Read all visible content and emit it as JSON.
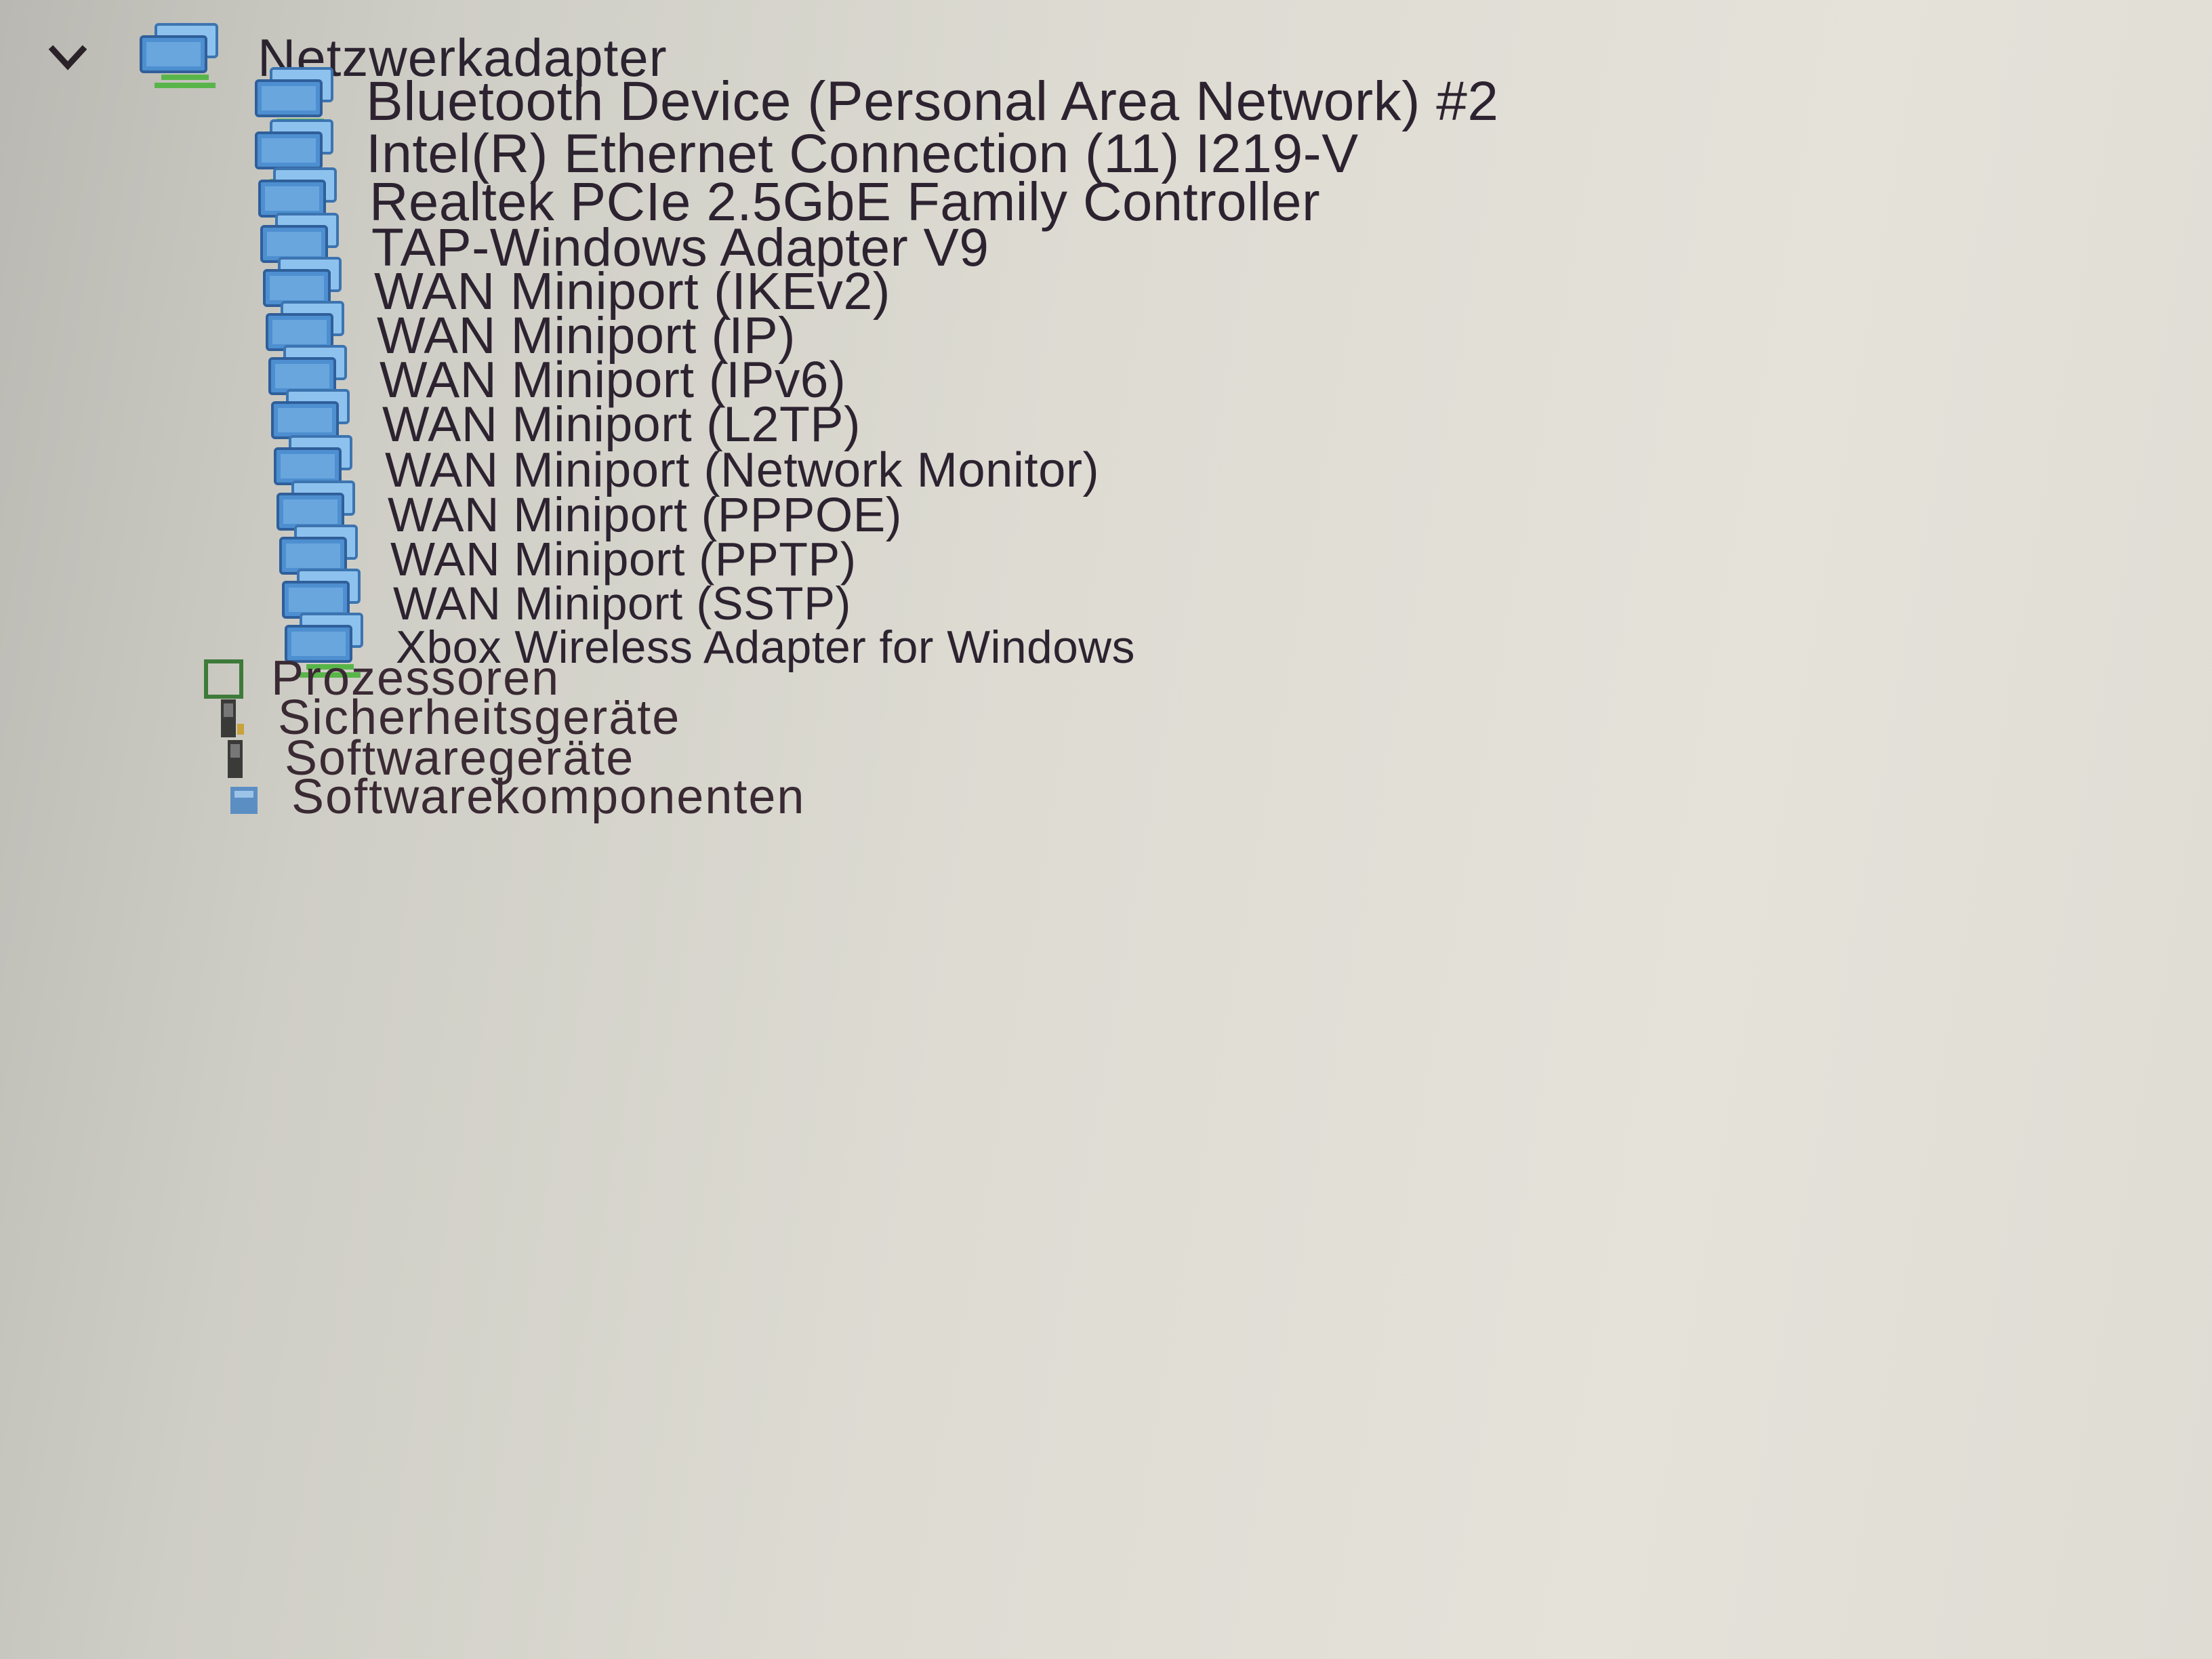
{
  "tree": {
    "parent": {
      "label": "Netzwerkadapter",
      "icon": "network-adapter-icon",
      "expanded": true
    },
    "children": [
      {
        "label": "Bluetooth Device (Personal Area Network) #2",
        "icon": "network-adapter-icon"
      },
      {
        "label": "Intel(R) Ethernet Connection (11) I219-V",
        "icon": "network-adapter-icon"
      },
      {
        "label": "Realtek PCIe 2.5GbE Family Controller",
        "icon": "network-adapter-icon"
      },
      {
        "label": "TAP-Windows Adapter V9",
        "icon": "network-adapter-icon"
      },
      {
        "label": "WAN Miniport (IKEv2)",
        "icon": "network-adapter-icon"
      },
      {
        "label": "WAN Miniport (IP)",
        "icon": "network-adapter-icon"
      },
      {
        "label": "WAN Miniport (IPv6)",
        "icon": "network-adapter-icon"
      },
      {
        "label": "WAN Miniport (L2TP)",
        "icon": "network-adapter-icon"
      },
      {
        "label": "WAN Miniport (Network Monitor)",
        "icon": "network-adapter-icon"
      },
      {
        "label": "WAN Miniport (PPPOE)",
        "icon": "network-adapter-icon"
      },
      {
        "label": "WAN Miniport (PPTP)",
        "icon": "network-adapter-icon"
      },
      {
        "label": "WAN Miniport (SSTP)",
        "icon": "network-adapter-icon"
      },
      {
        "label": "Xbox Wireless Adapter for Windows",
        "icon": "network-adapter-icon"
      }
    ],
    "categories": [
      {
        "label": "Prozessoren",
        "icon": "processor-icon"
      },
      {
        "label": "Sicherheitsgeräte",
        "icon": "security-device-icon"
      },
      {
        "label": "Softwaregeräte",
        "icon": "software-device-icon"
      },
      {
        "label": "Softwarekomponenten",
        "icon": "software-component-icon"
      }
    ]
  },
  "colors": {
    "icon_blue": "#4d8fd0",
    "icon_blue_light": "#8ec2ee",
    "icon_green": "#59b54a",
    "text": "#2b2330",
    "processor_green": "#3e7a3a"
  }
}
